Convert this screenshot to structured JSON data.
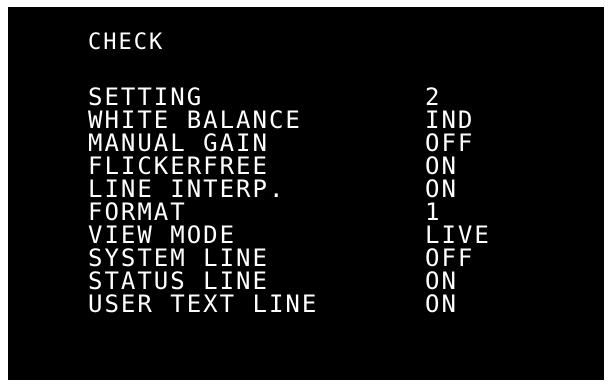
{
  "menu": {
    "title": "CHECK",
    "rows": [
      {
        "label": "SETTING",
        "value": "2"
      },
      {
        "label": "WHITE BALANCE",
        "value": "IND"
      },
      {
        "label": "MANUAL GAIN",
        "value": "OFF"
      },
      {
        "label": "FLICKERFREE",
        "value": "ON"
      },
      {
        "label": "LINE INTERP.",
        "value": "ON"
      },
      {
        "label": "FORMAT",
        "value": "1"
      },
      {
        "label": "VIEW MODE",
        "value": "LIVE"
      },
      {
        "label": "SYSTEM LINE",
        "value": "OFF"
      },
      {
        "label": "STATUS LINE",
        "value": "ON"
      },
      {
        "label": "USER TEXT LINE",
        "value": "ON"
      }
    ]
  },
  "colors": {
    "background": "#000000",
    "text": "#ffffff",
    "frame": "#ffffff"
  }
}
